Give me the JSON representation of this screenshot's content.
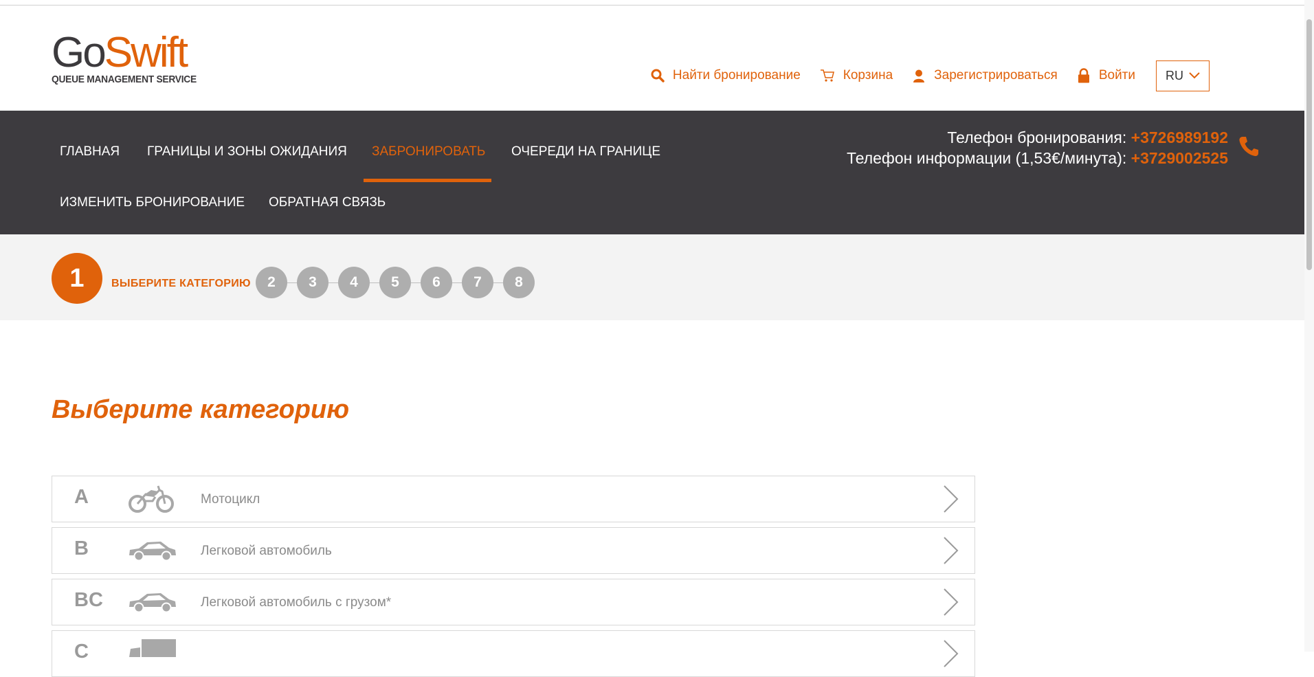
{
  "brand": {
    "name_part1": "Go",
    "name_part2": "Swift",
    "tagline": "QUEUE MANAGEMENT SERVICE",
    "accent_color": "#e0620b",
    "dark_color": "#3d3b3f"
  },
  "utility_links": [
    {
      "label": "Найти бронирование",
      "icon": "search-icon"
    },
    {
      "label": "Корзина",
      "icon": "cart-icon"
    },
    {
      "label": "Зарегистрироваться",
      "icon": "user-icon"
    },
    {
      "label": "Войти",
      "icon": "lock-icon"
    }
  ],
  "language": {
    "selected": "RU"
  },
  "nav": {
    "items": [
      {
        "label": "ГЛАВНАЯ"
      },
      {
        "label": "ГРАНИЦЫ И ЗОНЫ ОЖИДАНИЯ"
      },
      {
        "label": "ЗАБРОНИРОВАТЬ",
        "active": true
      },
      {
        "label": "ОЧЕРЕДИ НА ГРАНИЦЕ"
      },
      {
        "label": "ИЗМЕНИТЬ БРОНИРОВАНИЕ"
      },
      {
        "label": "ОБРАТНАЯ СВЯЗЬ"
      }
    ]
  },
  "contacts": {
    "booking_label": "Телефон бронирования:",
    "booking_number": "+3726989192",
    "info_label": "Телефон информации (1,53€/минута):",
    "info_number": "+3729002525"
  },
  "steps": {
    "current": "1",
    "current_label": "ВЫБЕРИТЕ КАТЕГОРИЮ",
    "others": [
      "2",
      "3",
      "4",
      "5",
      "6",
      "7",
      "8"
    ]
  },
  "page_title": "Выберите категорию",
  "categories": [
    {
      "code": "A",
      "name": "Мотоцикл",
      "icon": "motorcycle-icon"
    },
    {
      "code": "B",
      "name": "Легковой автомобиль",
      "icon": "car-icon"
    },
    {
      "code": "BC",
      "name": "Легковой автомобиль с грузом*",
      "icon": "car-icon"
    },
    {
      "code": "C",
      "name": "",
      "icon": "truck-icon"
    }
  ]
}
